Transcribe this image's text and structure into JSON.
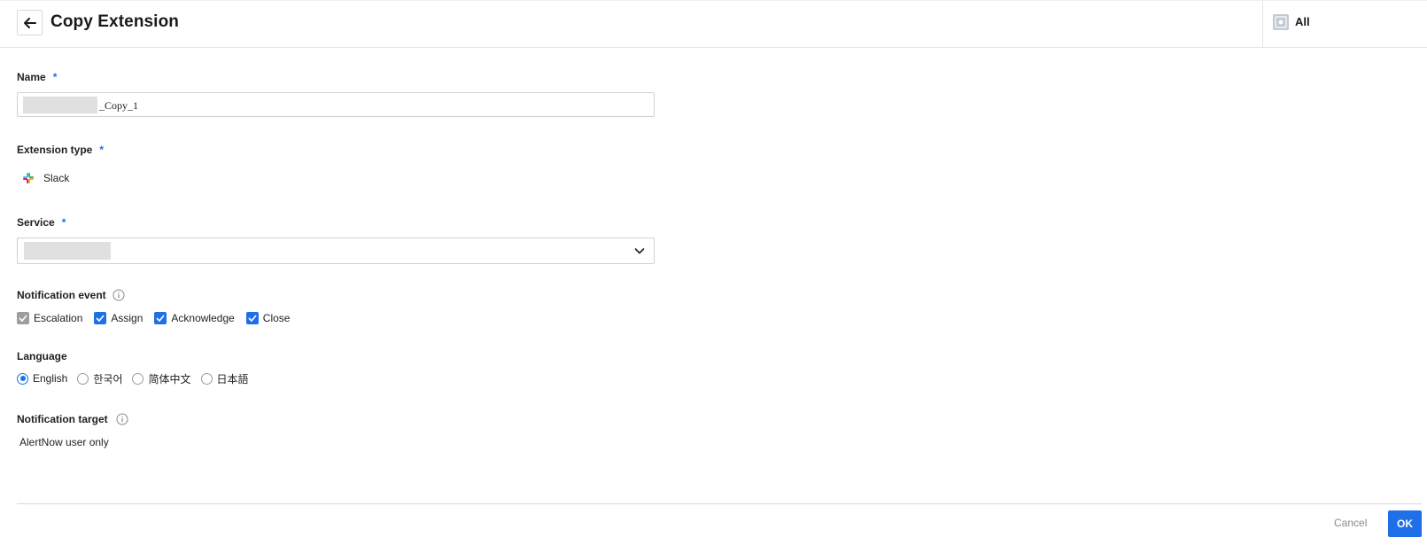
{
  "header": {
    "back_icon": "arrow-left-icon",
    "title": "Copy Extension",
    "scope_icon": "organization-icon",
    "scope_label": "All"
  },
  "form": {
    "name": {
      "label": "Name",
      "required_mark": "*",
      "value_suffix": "_Copy_1"
    },
    "extension_type": {
      "label": "Extension type",
      "required_mark": "*",
      "icon": "slack-icon",
      "value": "Slack"
    },
    "service": {
      "label": "Service",
      "required_mark": "*",
      "dropdown_icon": "chevron-down-icon"
    },
    "notification_event": {
      "label": "Notification event",
      "info_icon": "info-icon",
      "options": [
        {
          "label": "Escalation",
          "checked": true,
          "disabled": true
        },
        {
          "label": "Assign",
          "checked": true,
          "disabled": false
        },
        {
          "label": "Acknowledge",
          "checked": true,
          "disabled": false
        },
        {
          "label": "Close",
          "checked": true,
          "disabled": false
        }
      ]
    },
    "language": {
      "label": "Language",
      "options": [
        {
          "label": "English",
          "selected": true
        },
        {
          "label": "한국어",
          "selected": false
        },
        {
          "label": "简体中文",
          "selected": false
        },
        {
          "label": "日本語",
          "selected": false
        }
      ]
    },
    "notification_target": {
      "label": "Notification target",
      "info_icon": "info-icon",
      "value": "AlertNow user only"
    }
  },
  "footer": {
    "cancel_label": "Cancel",
    "ok_label": "OK"
  },
  "colors": {
    "accent": "#1e6fe8",
    "disabled_check": "#9e9e9e",
    "border": "#d0d0d0"
  }
}
